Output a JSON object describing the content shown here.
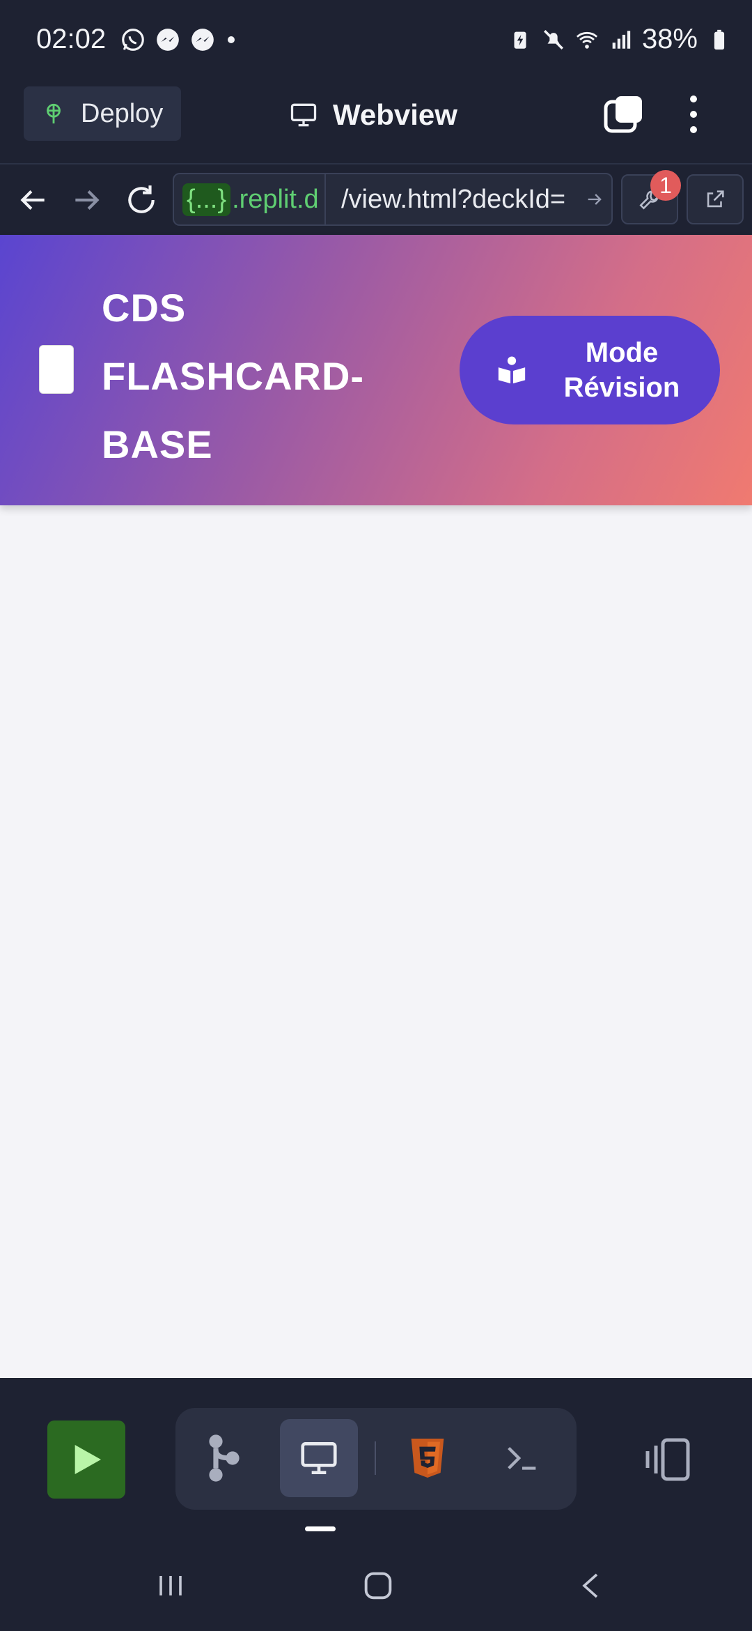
{
  "status_bar": {
    "time": "02:02",
    "battery": "38%",
    "left_icons": [
      "whatsapp-icon",
      "messenger-icon",
      "messenger-icon",
      "dot-icon"
    ],
    "right_icons": [
      "battery-saver-icon",
      "mute-icon",
      "wifi-icon",
      "signal-icon",
      "battery-icon"
    ]
  },
  "topbar": {
    "deploy_label": "Deploy",
    "title": "Webview"
  },
  "urlbar": {
    "host_chip": "{...}",
    "host_text": ".replit.d",
    "path": "/view.html?deckId=",
    "badge_count": "1"
  },
  "app": {
    "title_line1": "CDS",
    "title_line2": "FLASHCARD-",
    "title_line3": "BASE",
    "logo_icon": "joker-card-icon",
    "revision_line1": "Mode",
    "revision_line2": "Révision",
    "header_gradient": [
      "#5a45d0",
      "#f07a70"
    ],
    "button_color": "#5b3fcf",
    "content_background": "#f4f4f8"
  },
  "bottom_toolbar": {
    "run_color": "#2b6a21",
    "tools": [
      "git-icon",
      "webview-icon",
      "html5-icon",
      "shell-icon"
    ],
    "active_tool": "webview-icon"
  }
}
